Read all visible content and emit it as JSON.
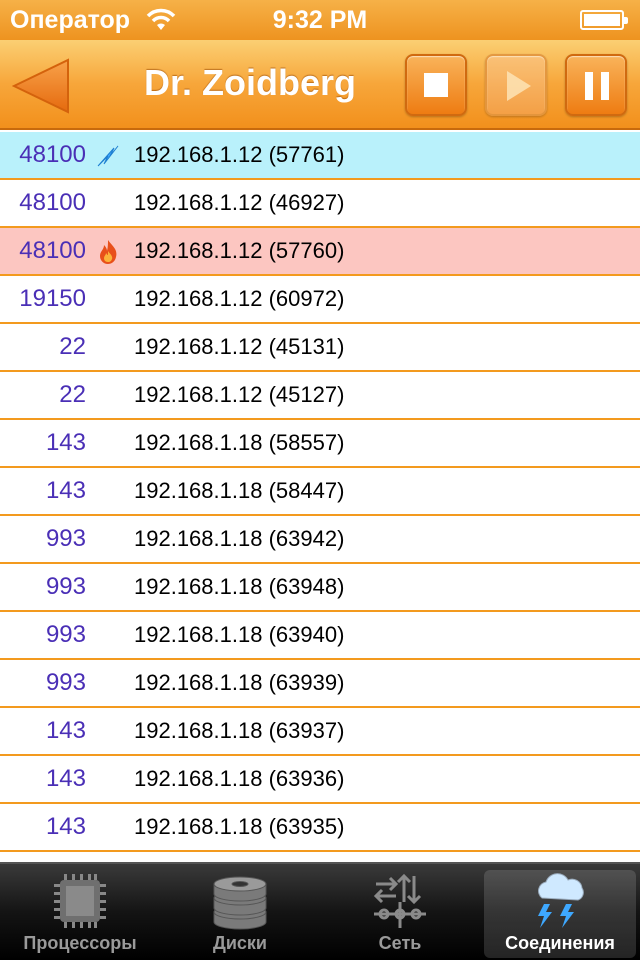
{
  "status_bar": {
    "carrier": "Оператор",
    "time": "9:32 PM",
    "wifi_icon": "wifi-icon",
    "battery_icon": "battery-icon"
  },
  "nav": {
    "title": "Dr. Zoidberg",
    "back_icon": "back-arrow-icon",
    "buttons": [
      "stop",
      "play",
      "pause"
    ],
    "accent_color": "#f2901c"
  },
  "connections": [
    {
      "port": "48100",
      "address": "192.168.1.12 (57761)",
      "icon": "lightning-icon",
      "highlight": "blue"
    },
    {
      "port": "48100",
      "address": "192.168.1.12 (46927)",
      "icon": "",
      "highlight": ""
    },
    {
      "port": "48100",
      "address": "192.168.1.12 (57760)",
      "icon": "fire-icon",
      "highlight": "red"
    },
    {
      "port": "19150",
      "address": "192.168.1.12 (60972)",
      "icon": "",
      "highlight": ""
    },
    {
      "port": "22",
      "address": "192.168.1.12 (45131)",
      "icon": "",
      "highlight": ""
    },
    {
      "port": "22",
      "address": "192.168.1.12 (45127)",
      "icon": "",
      "highlight": ""
    },
    {
      "port": "143",
      "address": "192.168.1.18 (58557)",
      "icon": "",
      "highlight": ""
    },
    {
      "port": "143",
      "address": "192.168.1.18 (58447)",
      "icon": "",
      "highlight": ""
    },
    {
      "port": "993",
      "address": "192.168.1.18 (63942)",
      "icon": "",
      "highlight": ""
    },
    {
      "port": "993",
      "address": "192.168.1.18 (63948)",
      "icon": "",
      "highlight": ""
    },
    {
      "port": "993",
      "address": "192.168.1.18 (63940)",
      "icon": "",
      "highlight": ""
    },
    {
      "port": "993",
      "address": "192.168.1.18 (63939)",
      "icon": "",
      "highlight": ""
    },
    {
      "port": "143",
      "address": "192.168.1.18 (63937)",
      "icon": "",
      "highlight": ""
    },
    {
      "port": "143",
      "address": "192.168.1.18 (63936)",
      "icon": "",
      "highlight": ""
    },
    {
      "port": "143",
      "address": "192.168.1.18 (63935)",
      "icon": "",
      "highlight": ""
    }
  ],
  "tabs": [
    {
      "label": "Процессоры",
      "icon": "cpu-chip-icon",
      "selected": false
    },
    {
      "label": "Диски",
      "icon": "disk-stack-icon",
      "selected": false
    },
    {
      "label": "Сеть",
      "icon": "network-icon",
      "selected": false
    },
    {
      "label": "Соединения",
      "icon": "storm-cloud-icon",
      "selected": true
    }
  ],
  "colors": {
    "row_highlight_blue": "#b9f1fb",
    "row_highlight_red": "#fcc6c1",
    "port_text": "#4a2fb6",
    "row_divider": "#f39a1e"
  }
}
